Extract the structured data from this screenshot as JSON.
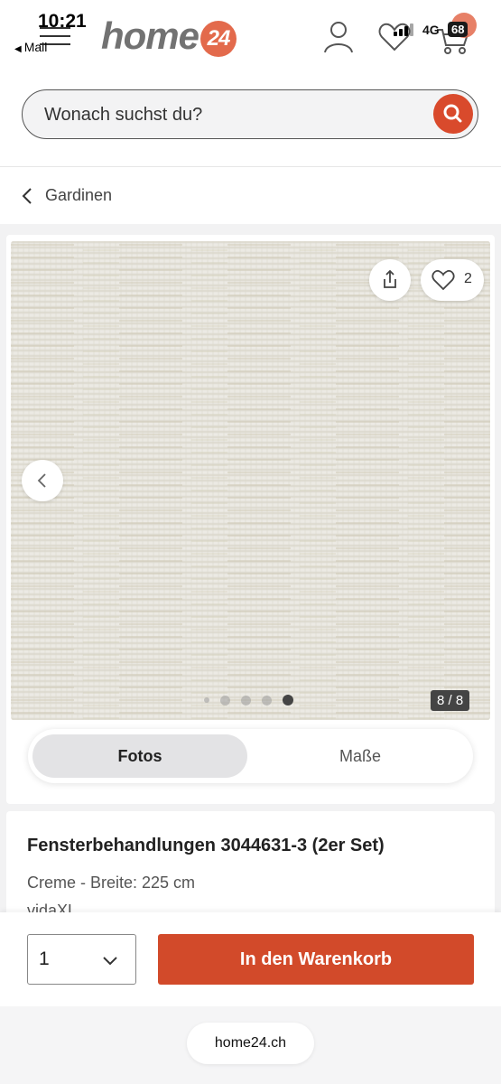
{
  "status_bar": {
    "time": "10:21",
    "back_label": "Mail",
    "network": "4G",
    "battery": "68"
  },
  "header": {
    "logo_text": "home",
    "logo_badge": "24",
    "brand_color": "#e36a4c"
  },
  "search": {
    "placeholder": "Wonach suchst du?"
  },
  "breadcrumb": {
    "label": "Gardinen"
  },
  "gallery": {
    "wishlist_count": "2",
    "counter": "8 / 8",
    "total_images": 8,
    "current_image": 8,
    "toggle": {
      "active": "Fotos",
      "other": "Maße"
    }
  },
  "product": {
    "title": "Fensterbehandlungen 3044631-3 (2er Set)",
    "variant": "Creme - Breite: 225 cm",
    "brand": "vidaXL"
  },
  "purchase": {
    "quantity": "1",
    "add_to_cart_label": "In den Warenkorb",
    "button_color": "#d24a2a"
  },
  "browser": {
    "url": "home24.ch"
  }
}
